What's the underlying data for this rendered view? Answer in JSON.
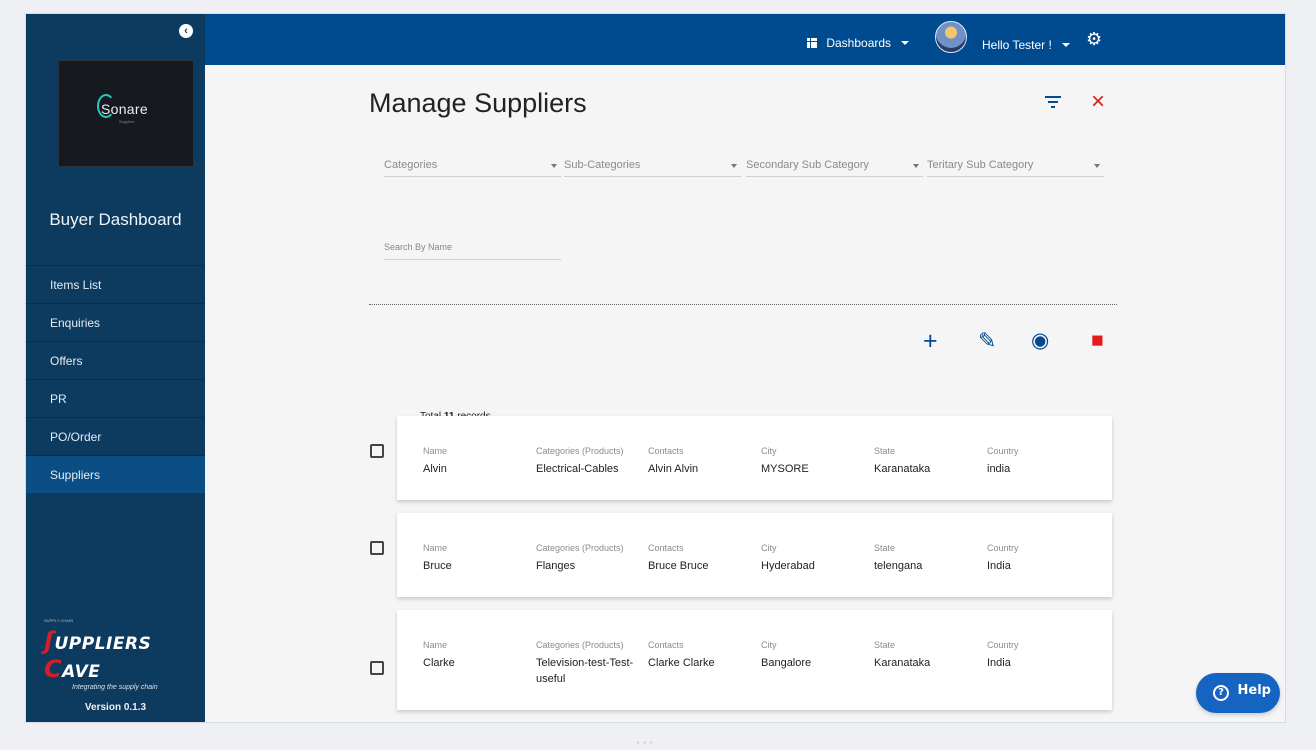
{
  "sidebar": {
    "logo": "Sonare",
    "dashboard_title": "Buyer Dashboard",
    "items": [
      {
        "label": "Items List"
      },
      {
        "label": "Enquiries"
      },
      {
        "label": "Offers"
      },
      {
        "label": "PR"
      },
      {
        "label": "PO/Order"
      },
      {
        "label": "Suppliers"
      }
    ],
    "brand": {
      "name": "SUPPLIERS CAVE",
      "tagline": "Integrating the supply chain"
    },
    "version": "Version 0.1.3"
  },
  "topbar": {
    "dashboards": "Dashboards",
    "user": "Hello Tester !"
  },
  "page": {
    "title": "Manage Suppliers",
    "filters": {
      "categories": "Categories",
      "sub_categories": "Sub-Categories",
      "secondary": "Secondary Sub Category",
      "tertiary": "Teritary Sub Category"
    },
    "search_placeholder": "Search By Name",
    "total_prefix": "Total",
    "total_count": "11",
    "total_suffix": "records"
  },
  "columns": {
    "name": "Name",
    "categories": "Categories (Products)",
    "contacts": "Contacts",
    "city": "City",
    "state": "State",
    "country": "Country"
  },
  "suppliers": [
    {
      "name": "Alvin",
      "categories": "Electrical-Cables",
      "contacts": "Alvin Alvin",
      "city": "MYSORE",
      "state": "Karanataka",
      "country": "india"
    },
    {
      "name": "Bruce",
      "categories": "Flanges",
      "contacts": "Bruce Bruce",
      "city": "Hyderabad",
      "state": "telengana",
      "country": "India"
    },
    {
      "name": "Clarke",
      "categories": "Television-test-Test-useful",
      "contacts": "Clarke Clarke",
      "city": "Bangalore",
      "state": "Karanataka",
      "country": "India"
    }
  ],
  "help": "Help",
  "colors": {
    "sidebar": "#0d3a5f",
    "topbar": "#004a8f",
    "active_nav": "#0b4d85",
    "delete": "#e31b1b",
    "help": "#1664c2"
  },
  "icons": [
    "grid-icon",
    "chevron-down-icon",
    "gear-icon",
    "filter-icon",
    "close-icon",
    "add-icon",
    "edit-icon",
    "view-icon",
    "delete-icon",
    "checkbox-icon",
    "help-icon"
  ]
}
